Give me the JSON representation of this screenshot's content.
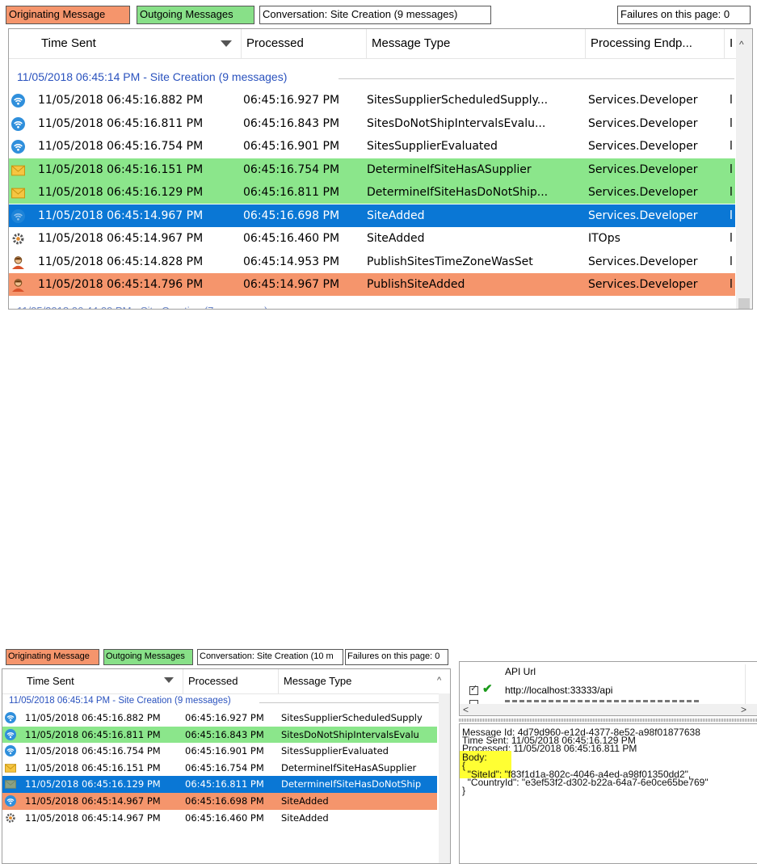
{
  "top": {
    "legend": {
      "originating": "Originating Message",
      "outgoing": "Outgoing Messages",
      "conversation": "Conversation: Site Creation (9 messages)",
      "failures": "Failures on this page: 0"
    },
    "columns": {
      "time_sent": "Time Sent",
      "processed": "Processed",
      "message_type": "Message Type",
      "endpoint": "Processing Endp...",
      "extra": "I"
    },
    "group_header": "11/05/2018 06:45:14 PM - Site Creation (9 messages)",
    "rows": [
      {
        "icon": "wifi-icon",
        "time": "11/05/2018 06:45:16.882 PM",
        "processed": "06:45:16.927 PM",
        "type": "SitesSupplierScheduledSupply...",
        "endpoint": "Services.Developer",
        "extra": "l",
        "style": "normal"
      },
      {
        "icon": "wifi-icon",
        "time": "11/05/2018 06:45:16.811 PM",
        "processed": "06:45:16.843 PM",
        "type": "SitesDoNotShipIntervalsEvalu...",
        "endpoint": "Services.Developer",
        "extra": "l",
        "style": "normal"
      },
      {
        "icon": "wifi-icon",
        "time": "11/05/2018 06:45:16.754 PM",
        "processed": "06:45:16.901 PM",
        "type": "SitesSupplierEvaluated",
        "endpoint": "Services.Developer",
        "extra": "l",
        "style": "normal"
      },
      {
        "icon": "envelope-icon",
        "time": "11/05/2018 06:45:16.151 PM",
        "processed": "06:45:16.754 PM",
        "type": "DetermineIfSiteHasASupplier",
        "endpoint": "Services.Developer",
        "extra": "l",
        "style": "green"
      },
      {
        "icon": "envelope-icon",
        "time": "11/05/2018 06:45:16.129 PM",
        "processed": "06:45:16.811 PM",
        "type": "DetermineIfSiteHasDoNotShip...",
        "endpoint": "Services.Developer",
        "extra": "l",
        "style": "green"
      },
      {
        "icon": "wifi-icon",
        "time": "11/05/2018 06:45:14.967 PM",
        "processed": "06:45:16.698 PM",
        "type": "SiteAdded",
        "endpoint": "Services.Developer",
        "extra": "l",
        "style": "sel"
      },
      {
        "icon": "gear-icon",
        "time": "11/05/2018 06:45:14.967 PM",
        "processed": "06:45:16.460 PM",
        "type": "SiteAdded",
        "endpoint": "ITOps",
        "extra": "l",
        "style": "normal"
      },
      {
        "icon": "person-icon",
        "time": "11/05/2018 06:45:14.828 PM",
        "processed": "06:45:14.953 PM",
        "type": "PublishSitesTimeZoneWasSet",
        "endpoint": "Services.Developer",
        "extra": "l",
        "style": "normal"
      },
      {
        "icon": "person-icon",
        "time": "11/05/2018 06:45:14.796 PM",
        "processed": "06:45:14.967 PM",
        "type": "PublishSiteAdded",
        "endpoint": "Services.Developer",
        "extra": "l",
        "style": "orange"
      }
    ]
  },
  "bottom": {
    "legend": {
      "originating": "Originating Message",
      "outgoing": "Outgoing Messages",
      "conversation": "Conversation: Site Creation (10 m",
      "failures": "Failures on this page: 0"
    },
    "columns": {
      "time_sent": "Time Sent",
      "processed": "Processed",
      "message_type": "Message Type"
    },
    "group_header": "11/05/2018 06:45:14 PM - Site Creation (9 messages)",
    "rows": [
      {
        "icon": "wifi-icon",
        "time": "11/05/2018 06:45:16.882 PM",
        "processed": "06:45:16.927 PM",
        "type": "SitesSupplierScheduledSupply",
        "style": "normal"
      },
      {
        "icon": "wifi-icon",
        "time": "11/05/2018 06:45:16.811 PM",
        "processed": "06:45:16.843 PM",
        "type": "SitesDoNotShipIntervalsEvalu",
        "style": "green"
      },
      {
        "icon": "wifi-icon",
        "time": "11/05/2018 06:45:16.754 PM",
        "processed": "06:45:16.901 PM",
        "type": "SitesSupplierEvaluated",
        "style": "normal"
      },
      {
        "icon": "envelope-icon",
        "time": "11/05/2018 06:45:16.151 PM",
        "processed": "06:45:16.754 PM",
        "type": "DetermineIfSiteHasASupplier",
        "style": "normal"
      },
      {
        "icon": "envelope-icon",
        "time": "11/05/2018 06:45:16.129 PM",
        "processed": "06:45:16.811 PM",
        "type": "DetermineIfSiteHasDoNotShip",
        "style": "sel"
      },
      {
        "icon": "wifi-icon",
        "time": "11/05/2018 06:45:14.967 PM",
        "processed": "06:45:16.698 PM",
        "type": "SiteAdded",
        "style": "orange"
      },
      {
        "icon": "gear-icon",
        "time": "11/05/2018 06:45:14.967 PM",
        "processed": "06:45:16.460 PM",
        "type": "SiteAdded",
        "style": "normal"
      }
    ],
    "api": {
      "header": "API Url",
      "url": "http://localhost:33333/api"
    },
    "details": {
      "message_id": "Message Id: 4d79d960-e12d-4377-8e52-a98f01877638",
      "time_sent": "Time Sent: 11/05/2018 06:45:16.129 PM",
      "processed": "Processed: 11/05/2018 06:45:16.811 PM",
      "body_label": "Body:",
      "open_brace": "{",
      "site_id": "  \"SiteId\": \"f83f1d1a-802c-4046-a4ed-a98f01350dd2\",",
      "country_id": "  \"CountryId\": \"e3ef53f2-d302-b22a-64a7-6e0ce65be769\"",
      "close_brace": "}"
    }
  },
  "colors": {
    "originating": "#f5956c",
    "outgoing": "#88e088",
    "selected": "#0a77d5",
    "group_text": "#2a52be",
    "highlight": "#ffff33"
  }
}
